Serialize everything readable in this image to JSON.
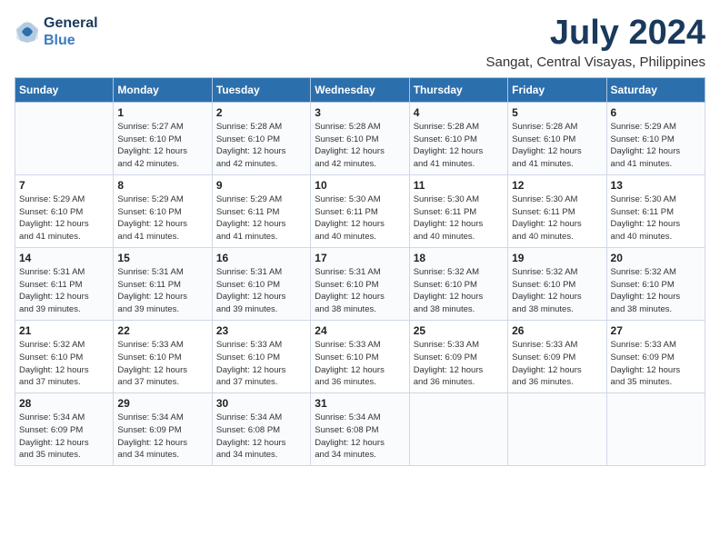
{
  "header": {
    "logo_line1": "General",
    "logo_line2": "Blue",
    "month_title": "July 2024",
    "location": "Sangat, Central Visayas, Philippines"
  },
  "days_of_week": [
    "Sunday",
    "Monday",
    "Tuesday",
    "Wednesday",
    "Thursday",
    "Friday",
    "Saturday"
  ],
  "weeks": [
    [
      {
        "day": "",
        "info": ""
      },
      {
        "day": "1",
        "info": "Sunrise: 5:27 AM\nSunset: 6:10 PM\nDaylight: 12 hours\nand 42 minutes."
      },
      {
        "day": "2",
        "info": "Sunrise: 5:28 AM\nSunset: 6:10 PM\nDaylight: 12 hours\nand 42 minutes."
      },
      {
        "day": "3",
        "info": "Sunrise: 5:28 AM\nSunset: 6:10 PM\nDaylight: 12 hours\nand 42 minutes."
      },
      {
        "day": "4",
        "info": "Sunrise: 5:28 AM\nSunset: 6:10 PM\nDaylight: 12 hours\nand 41 minutes."
      },
      {
        "day": "5",
        "info": "Sunrise: 5:28 AM\nSunset: 6:10 PM\nDaylight: 12 hours\nand 41 minutes."
      },
      {
        "day": "6",
        "info": "Sunrise: 5:29 AM\nSunset: 6:10 PM\nDaylight: 12 hours\nand 41 minutes."
      }
    ],
    [
      {
        "day": "7",
        "info": "Sunrise: 5:29 AM\nSunset: 6:10 PM\nDaylight: 12 hours\nand 41 minutes."
      },
      {
        "day": "8",
        "info": "Sunrise: 5:29 AM\nSunset: 6:10 PM\nDaylight: 12 hours\nand 41 minutes."
      },
      {
        "day": "9",
        "info": "Sunrise: 5:29 AM\nSunset: 6:11 PM\nDaylight: 12 hours\nand 41 minutes."
      },
      {
        "day": "10",
        "info": "Sunrise: 5:30 AM\nSunset: 6:11 PM\nDaylight: 12 hours\nand 40 minutes."
      },
      {
        "day": "11",
        "info": "Sunrise: 5:30 AM\nSunset: 6:11 PM\nDaylight: 12 hours\nand 40 minutes."
      },
      {
        "day": "12",
        "info": "Sunrise: 5:30 AM\nSunset: 6:11 PM\nDaylight: 12 hours\nand 40 minutes."
      },
      {
        "day": "13",
        "info": "Sunrise: 5:30 AM\nSunset: 6:11 PM\nDaylight: 12 hours\nand 40 minutes."
      }
    ],
    [
      {
        "day": "14",
        "info": "Sunrise: 5:31 AM\nSunset: 6:11 PM\nDaylight: 12 hours\nand 39 minutes."
      },
      {
        "day": "15",
        "info": "Sunrise: 5:31 AM\nSunset: 6:11 PM\nDaylight: 12 hours\nand 39 minutes."
      },
      {
        "day": "16",
        "info": "Sunrise: 5:31 AM\nSunset: 6:10 PM\nDaylight: 12 hours\nand 39 minutes."
      },
      {
        "day": "17",
        "info": "Sunrise: 5:31 AM\nSunset: 6:10 PM\nDaylight: 12 hours\nand 38 minutes."
      },
      {
        "day": "18",
        "info": "Sunrise: 5:32 AM\nSunset: 6:10 PM\nDaylight: 12 hours\nand 38 minutes."
      },
      {
        "day": "19",
        "info": "Sunrise: 5:32 AM\nSunset: 6:10 PM\nDaylight: 12 hours\nand 38 minutes."
      },
      {
        "day": "20",
        "info": "Sunrise: 5:32 AM\nSunset: 6:10 PM\nDaylight: 12 hours\nand 38 minutes."
      }
    ],
    [
      {
        "day": "21",
        "info": "Sunrise: 5:32 AM\nSunset: 6:10 PM\nDaylight: 12 hours\nand 37 minutes."
      },
      {
        "day": "22",
        "info": "Sunrise: 5:33 AM\nSunset: 6:10 PM\nDaylight: 12 hours\nand 37 minutes."
      },
      {
        "day": "23",
        "info": "Sunrise: 5:33 AM\nSunset: 6:10 PM\nDaylight: 12 hours\nand 37 minutes."
      },
      {
        "day": "24",
        "info": "Sunrise: 5:33 AM\nSunset: 6:10 PM\nDaylight: 12 hours\nand 36 minutes."
      },
      {
        "day": "25",
        "info": "Sunrise: 5:33 AM\nSunset: 6:09 PM\nDaylight: 12 hours\nand 36 minutes."
      },
      {
        "day": "26",
        "info": "Sunrise: 5:33 AM\nSunset: 6:09 PM\nDaylight: 12 hours\nand 36 minutes."
      },
      {
        "day": "27",
        "info": "Sunrise: 5:33 AM\nSunset: 6:09 PM\nDaylight: 12 hours\nand 35 minutes."
      }
    ],
    [
      {
        "day": "28",
        "info": "Sunrise: 5:34 AM\nSunset: 6:09 PM\nDaylight: 12 hours\nand 35 minutes."
      },
      {
        "day": "29",
        "info": "Sunrise: 5:34 AM\nSunset: 6:09 PM\nDaylight: 12 hours\nand 34 minutes."
      },
      {
        "day": "30",
        "info": "Sunrise: 5:34 AM\nSunset: 6:08 PM\nDaylight: 12 hours\nand 34 minutes."
      },
      {
        "day": "31",
        "info": "Sunrise: 5:34 AM\nSunset: 6:08 PM\nDaylight: 12 hours\nand 34 minutes."
      },
      {
        "day": "",
        "info": ""
      },
      {
        "day": "",
        "info": ""
      },
      {
        "day": "",
        "info": ""
      }
    ]
  ]
}
